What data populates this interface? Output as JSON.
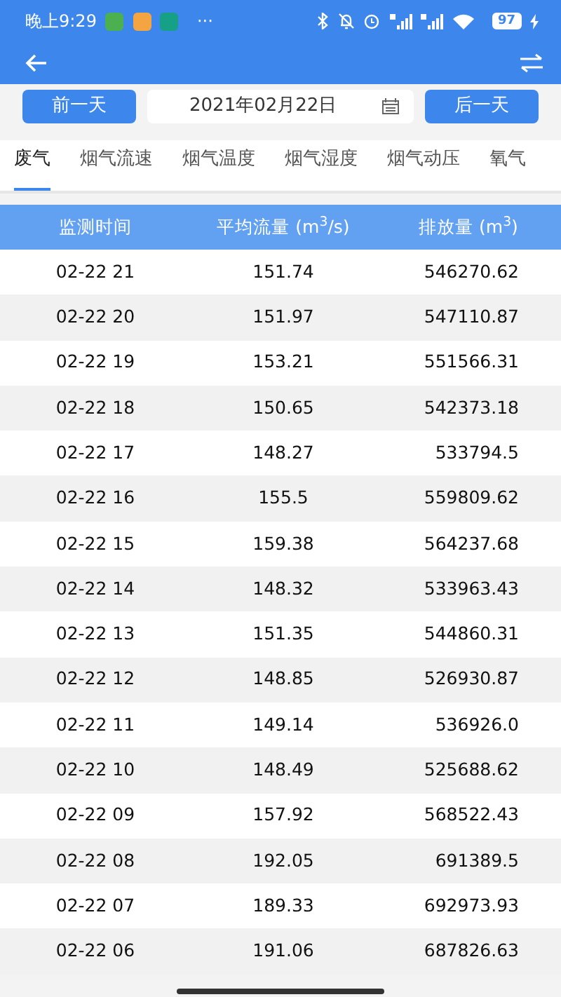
{
  "status_bar": {
    "time": "晚上9:29",
    "notification_icons": [
      {
        "color": "#4caf50"
      },
      {
        "color": "#f5a442"
      },
      {
        "color": "#16a085"
      }
    ],
    "more": "···",
    "battery": "97"
  },
  "date_bar": {
    "prev": "前一天",
    "date": "2021年02月22日",
    "next": "后一天"
  },
  "tabs": [
    {
      "label": "废气",
      "selected": true
    },
    {
      "label": "烟气流速",
      "selected": false
    },
    {
      "label": "烟气温度",
      "selected": false
    },
    {
      "label": "烟气湿度",
      "selected": false
    },
    {
      "label": "烟气动压",
      "selected": false
    },
    {
      "label": "氧气",
      "selected": false
    }
  ],
  "table": {
    "columns": [
      "监测时间",
      "平均流量 (m$^{3}$/s)",
      "排放量 (m$^{3}$)"
    ],
    "rows": [
      [
        "02-22 21",
        "151.74",
        "546270.62"
      ],
      [
        "02-22 20",
        "151.97",
        "547110.87"
      ],
      [
        "02-22 19",
        "153.21",
        "551566.31"
      ],
      [
        "02-22 18",
        "150.65",
        "542373.18"
      ],
      [
        "02-22 17",
        "148.27",
        "533794.5"
      ],
      [
        "02-22 16",
        "155.5",
        "559809.62"
      ],
      [
        "02-22 15",
        "159.38",
        "564237.68"
      ],
      [
        "02-22 14",
        "148.32",
        "533963.43"
      ],
      [
        "02-22 13",
        "151.35",
        "544860.31"
      ],
      [
        "02-22 12",
        "148.85",
        "526930.87"
      ],
      [
        "02-22 11",
        "149.14",
        "536926.0"
      ],
      [
        "02-22 10",
        "148.49",
        "525688.62"
      ],
      [
        "02-22 09",
        "157.92",
        "568522.43"
      ],
      [
        "02-22 08",
        "192.05",
        "691389.5"
      ],
      [
        "02-22 07",
        "189.33",
        "692973.93"
      ],
      [
        "02-22 06",
        "191.06",
        "687826.63"
      ]
    ]
  }
}
